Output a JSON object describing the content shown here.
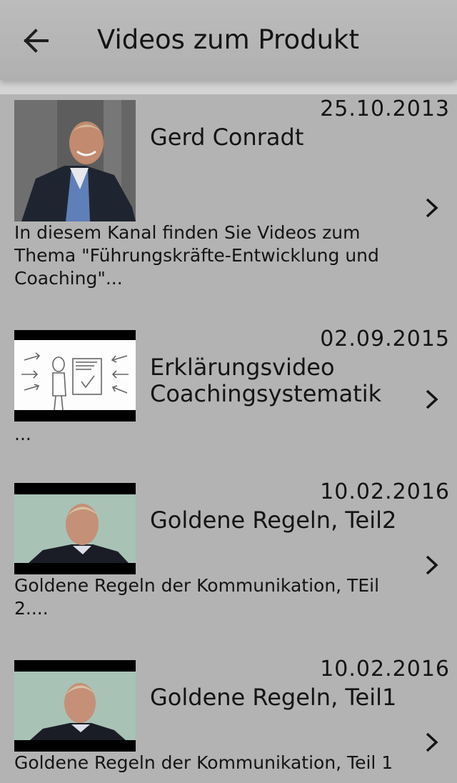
{
  "header": {
    "title": "Videos zum Produkt",
    "back_icon": "arrow-left-icon"
  },
  "videos": [
    {
      "date": "25.10.2013",
      "title": "Gerd Conradt",
      "description": "In diesem Kanal finden Sie Videos zum Thema \"Führungskräfte-Entwicklung und Coaching\"..."
    },
    {
      "date": "02.09.2015",
      "title": "Erklärungsvideo Coachingsystematik",
      "description": "..."
    },
    {
      "date": "10.02.2016",
      "title": "Goldene Regeln, Teil2",
      "description": "Goldene Regeln der Kommunikation, TEil 2...."
    },
    {
      "date": "10.02.2016",
      "title": "Goldene Regeln, Teil1",
      "description": "Goldene Regeln der Kommunikation, Teil 1"
    }
  ],
  "colors": {
    "background": "#b3b3b3",
    "text": "#141414"
  }
}
